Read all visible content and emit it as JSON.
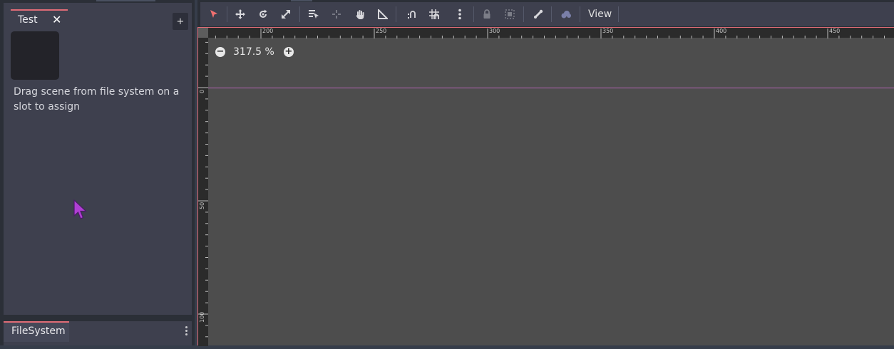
{
  "scene_panel": {
    "tab_label": "Test",
    "tab_close_icon": "close-icon",
    "add_tab_label": "+",
    "hint": "Drag scene from file system on a slot to assign"
  },
  "filesystem": {
    "tab_label": "FileSystem"
  },
  "toolbar": {
    "tools": [
      {
        "name": "select-tool-icon",
        "icon": "select"
      },
      {
        "name": "move-tool-icon",
        "icon": "move"
      },
      {
        "name": "rotate-tool-icon",
        "icon": "rotate"
      },
      {
        "name": "scale-tool-icon",
        "icon": "scale"
      },
      {
        "name": "list-select-tool-icon",
        "icon": "list-select"
      },
      {
        "name": "pivot-tool-icon",
        "icon": "pivot"
      },
      {
        "name": "pan-tool-icon",
        "icon": "pan"
      },
      {
        "name": "ruler-tool-icon",
        "icon": "ruler"
      },
      {
        "name": "smart-snap-icon",
        "icon": "smart-snap"
      },
      {
        "name": "grid-snap-icon",
        "icon": "grid-snap"
      },
      {
        "name": "snap-options-icon",
        "icon": "kebab"
      },
      {
        "name": "lock-icon",
        "icon": "lock"
      },
      {
        "name": "group-icon",
        "icon": "group"
      },
      {
        "name": "bone-icon",
        "icon": "bone"
      },
      {
        "name": "cloud-icon",
        "icon": "cloud"
      }
    ],
    "view_label": "View"
  },
  "zoom": {
    "level": "317.5 %",
    "minus_label": "−",
    "plus_label": "+"
  },
  "ruler": {
    "top_labels": [
      "200",
      "250",
      "300",
      "350",
      "400",
      "450"
    ],
    "left_labels": [
      "0",
      "50",
      "100"
    ]
  },
  "colors": {
    "accent": "#e06c77",
    "guide": "#b563b6",
    "select_tool": "#f07070"
  }
}
